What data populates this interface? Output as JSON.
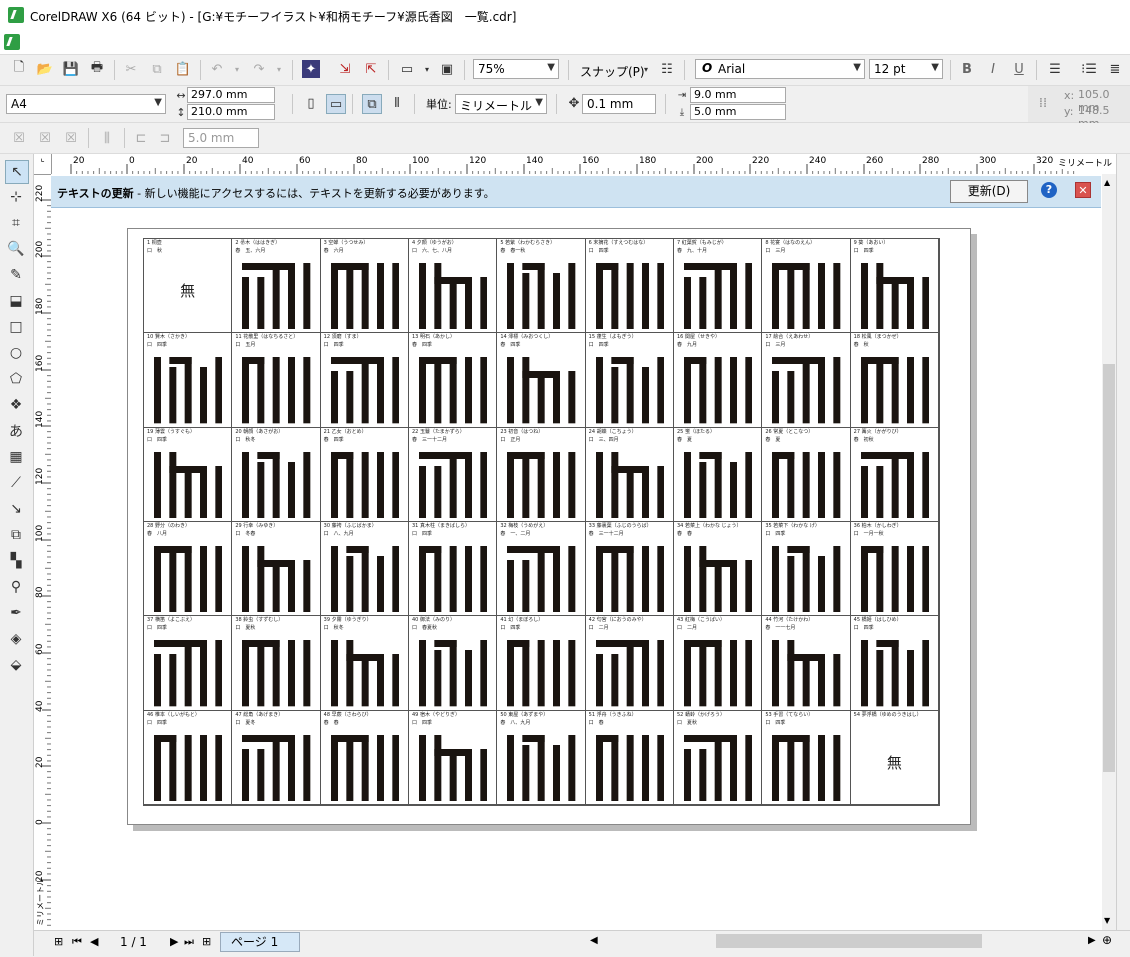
{
  "window": {
    "title": "CorelDRAW X6 (64 ビット) - [G:¥モチーフイラスト¥和柄モチーフ¥源氏香図　一覧.cdr]"
  },
  "toolbar": {
    "zoom": "75%",
    "snap": "スナップ(P)",
    "font_name": "Arial",
    "font_size": "12 pt"
  },
  "property_bar": {
    "page_size": "A4",
    "width": "297.0 mm",
    "height": "210.0 mm",
    "units_label": "単位:",
    "units": "ミリメートル",
    "nudge": "0.1 mm",
    "dup_x": "9.0 mm",
    "dup_y": "5.0 mm",
    "x_label": "x:",
    "x_value": "105.0 mm",
    "y_label": "y:",
    "y_value": "148.5 mm"
  },
  "effects_bar": {
    "offset": "5.0 mm"
  },
  "ruler": {
    "h_labels": [
      "20",
      "0",
      "20",
      "40",
      "60",
      "80",
      "100",
      "120",
      "140",
      "160",
      "180",
      "200",
      "220",
      "240",
      "260",
      "280",
      "300",
      "320"
    ],
    "h_unit": "ミリメートル",
    "v_labels": [
      "220",
      "200",
      "180",
      "160",
      "140",
      "120",
      "100",
      "80",
      "60",
      "40",
      "20",
      "0",
      "20"
    ],
    "v_unit": "ミリメートル"
  },
  "notification": {
    "bold": "テキストの更新",
    "message": " - 新しい機能にアクセスするには、テキストを更新する必要があります。",
    "update_button": "更新(D)",
    "help": "?",
    "close": "✕"
  },
  "status": {
    "page_counter": "1 / 1",
    "page_tab": "ページ 1"
  },
  "document": {
    "empty_mark": "無",
    "cells": [
      {
        "cap": "1 桐壺",
        "sub": "口　秋",
        "pattern": "none"
      },
      {
        "cap": "2 帚木（ははきぎ）",
        "sub": "春　五、六月",
        "pattern": "5"
      },
      {
        "cap": "3 空蝉（うつせみ）",
        "sub": "春　六月",
        "pattern": "4"
      },
      {
        "cap": "4 夕顔（ゆうがお）",
        "sub": "口　六、七、八月",
        "pattern": "4"
      },
      {
        "cap": "5 若紫（わかむらさき）",
        "sub": "春　春一秋",
        "pattern": "4"
      },
      {
        "cap": "6 末摘花（すえつむはな）",
        "sub": "口　四季",
        "pattern": "4"
      },
      {
        "cap": "7 紅葉賀（もみじが）",
        "sub": "春　九、十月",
        "pattern": "4"
      },
      {
        "cap": "8 花宴（はなのえん）",
        "sub": "口　三月",
        "pattern": "4"
      },
      {
        "cap": "9 葵（あおい）",
        "sub": "口　四季",
        "pattern": "4"
      },
      {
        "cap": "10 賢木（さかき）",
        "sub": "口　四季",
        "pattern": "4"
      },
      {
        "cap": "11 花散里（はなちるさと）",
        "sub": "口　五月",
        "pattern": "4"
      },
      {
        "cap": "12 須磨（すま）",
        "sub": "口　四季",
        "pattern": "4"
      },
      {
        "cap": "13 明石（あかし）",
        "sub": "春　四季",
        "pattern": "4"
      },
      {
        "cap": "14 澪標（みおつくし）",
        "sub": "春　四季",
        "pattern": "4"
      },
      {
        "cap": "15 蓬生（よもぎう）",
        "sub": "口　四季",
        "pattern": "4"
      },
      {
        "cap": "16 関屋（せきや）",
        "sub": "春　九月",
        "pattern": "4"
      },
      {
        "cap": "17 絵合（えあわせ）",
        "sub": "口　三月",
        "pattern": "4"
      },
      {
        "cap": "18 松風（まつかぜ）",
        "sub": "春　秋",
        "pattern": "4"
      },
      {
        "cap": "19 薄雲（うすぐも）",
        "sub": "口　四季",
        "pattern": "4"
      },
      {
        "cap": "20 朝顔（あさがお）",
        "sub": "口　秋冬",
        "pattern": "4"
      },
      {
        "cap": "21 乙女（おとめ）",
        "sub": "春　四季",
        "pattern": "4"
      },
      {
        "cap": "22 玉鬘（たまかずら）",
        "sub": "春　三一十二月",
        "pattern": "4"
      },
      {
        "cap": "23 初音（はつね）",
        "sub": "口　正月",
        "pattern": "4"
      },
      {
        "cap": "24 胡蝶（こちょう）",
        "sub": "口　三、四月",
        "pattern": "4"
      },
      {
        "cap": "25 蛍（ほたる）",
        "sub": "春　夏",
        "pattern": "4"
      },
      {
        "cap": "26 常夏（とこなつ）",
        "sub": "春　夏",
        "pattern": "4"
      },
      {
        "cap": "27 篝火（かがりび）",
        "sub": "春　初秋",
        "pattern": "4"
      },
      {
        "cap": "28 野分（のわき）",
        "sub": "春　八月",
        "pattern": "4"
      },
      {
        "cap": "29 行幸（みゆき）",
        "sub": "口　冬春",
        "pattern": "4"
      },
      {
        "cap": "30 藤袴（ふじばかま）",
        "sub": "口　八、九月",
        "pattern": "4"
      },
      {
        "cap": "31 真木柱（まきばしら）",
        "sub": "口　四季",
        "pattern": "4"
      },
      {
        "cap": "32 梅枝（うめがえ）",
        "sub": "春　一、二月",
        "pattern": "4"
      },
      {
        "cap": "33 藤裏葉（ふじのうらば）",
        "sub": "春　三一十二月",
        "pattern": "4"
      },
      {
        "cap": "34 若菜上（わかな じょう）",
        "sub": "春　春",
        "pattern": "4"
      },
      {
        "cap": "35 若菜下（わかな げ）",
        "sub": "口　四季",
        "pattern": "4"
      },
      {
        "cap": "36 柏木（かしわぎ）",
        "sub": "口　一月一秋",
        "pattern": "4"
      },
      {
        "cap": "37 横笛（よこぶえ）",
        "sub": "口　四季",
        "pattern": "4"
      },
      {
        "cap": "38 鈴虫（すずむし）",
        "sub": "口　夏秋",
        "pattern": "4"
      },
      {
        "cap": "39 夕霧（ゆうぎり）",
        "sub": "口　秋冬",
        "pattern": "4"
      },
      {
        "cap": "40 御法（みのり）",
        "sub": "口　春夏秋",
        "pattern": "4"
      },
      {
        "cap": "41 幻（まぼろし）",
        "sub": "口　四季",
        "pattern": "4"
      },
      {
        "cap": "42 匂宮（におうのみや）",
        "sub": "口　二月",
        "pattern": "4"
      },
      {
        "cap": "43 紅梅（こうばい）",
        "sub": "口　二月",
        "pattern": "4"
      },
      {
        "cap": "44 竹河（たけかわ）",
        "sub": "春　一一七月",
        "pattern": "4"
      },
      {
        "cap": "45 橋姫（はしひめ）",
        "sub": "口　四季",
        "pattern": "4"
      },
      {
        "cap": "46 椎本（しいがもと）",
        "sub": "口　四季",
        "pattern": "4"
      },
      {
        "cap": "47 総角（あげまき）",
        "sub": "口　夏冬",
        "pattern": "4"
      },
      {
        "cap": "48 早蕨（さわらび）",
        "sub": "春　春",
        "pattern": "4"
      },
      {
        "cap": "49 宿木（やどりぎ）",
        "sub": "口　四季",
        "pattern": "4"
      },
      {
        "cap": "50 東屋（あずまや）",
        "sub": "春　八、九月",
        "pattern": "4"
      },
      {
        "cap": "51 浮舟（うきふね）",
        "sub": "口　春",
        "pattern": "4"
      },
      {
        "cap": "52 蜻蛉（かげろう）",
        "sub": "口　夏秋",
        "pattern": "4"
      },
      {
        "cap": "53 手習（てならい）",
        "sub": "口　四季",
        "pattern": "4"
      },
      {
        "cap": "54 夢浮橋（ゆめのうきはし）",
        "sub": "",
        "pattern": "none"
      }
    ]
  }
}
